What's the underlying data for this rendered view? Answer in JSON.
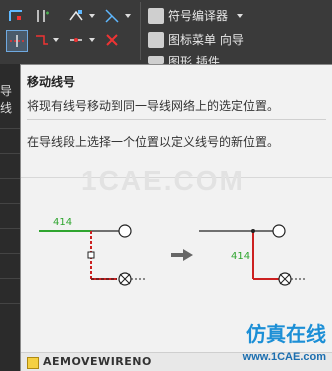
{
  "ribbon": {
    "buttons": [
      {
        "label": "符号编译器"
      },
      {
        "label": "图标菜单 向导"
      },
      {
        "label": "图形 插件"
      }
    ]
  },
  "sliver_label": "导线",
  "tooltip": {
    "title": "移动线号",
    "description": "将现有线号移动到同一导线网络上的选定位置。",
    "detail": "在导线段上选择一个位置以定义线号的新位置。",
    "watermark": "1CAE.COM",
    "wire_label_before": "414",
    "wire_label_after": "414",
    "command": "AEMOVEWIRENO"
  },
  "brand": {
    "name": "仿真在线",
    "url": "www.1CAE.com"
  },
  "colors": {
    "wire_green": "#2fa52f",
    "wire_red": "#cc2020",
    "accent_blue": "#1c8fd6"
  }
}
